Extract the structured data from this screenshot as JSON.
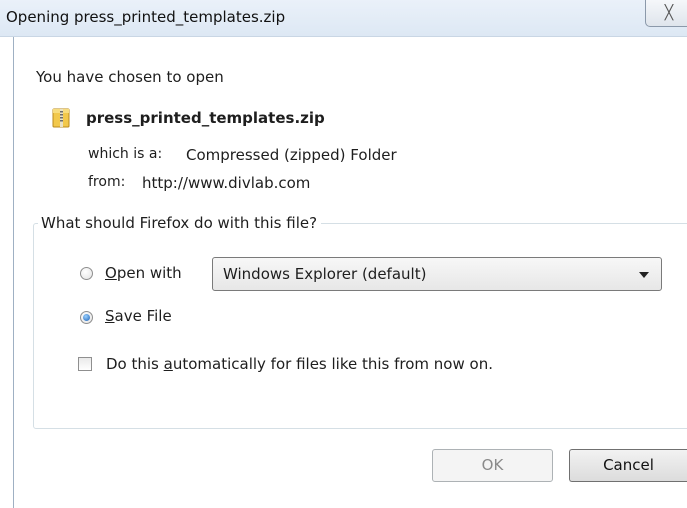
{
  "window": {
    "title": "Opening press_printed_templates.zip",
    "close_glyph": "╳"
  },
  "dialog": {
    "intro": "You have chosen to open",
    "file_name": "press_printed_templates.zip",
    "file_icon": "zip-folder-icon",
    "type_label": "which is a:",
    "type_value": "Compressed (zipped) Folder",
    "from_label": "from:",
    "from_value": "http://www.divlab.com"
  },
  "action_group": {
    "legend": "What should Firefox do with this file?",
    "open_with": {
      "accesskey": "O",
      "rest": "pen with",
      "selected": false
    },
    "app_select": {
      "value": "Windows Explorer (default)"
    },
    "save_file": {
      "accesskey": "S",
      "rest": "ave File",
      "selected": true
    },
    "auto": {
      "before": "Do this ",
      "accesskey": "a",
      "after": "utomatically for files like this from now on.",
      "checked": false
    }
  },
  "buttons": {
    "ok": "OK",
    "cancel": "Cancel"
  },
  "colors": {
    "titlebar": "#dde8f4",
    "group_border": "#d5dfe5",
    "radio_selected": "#1a5fb4"
  }
}
